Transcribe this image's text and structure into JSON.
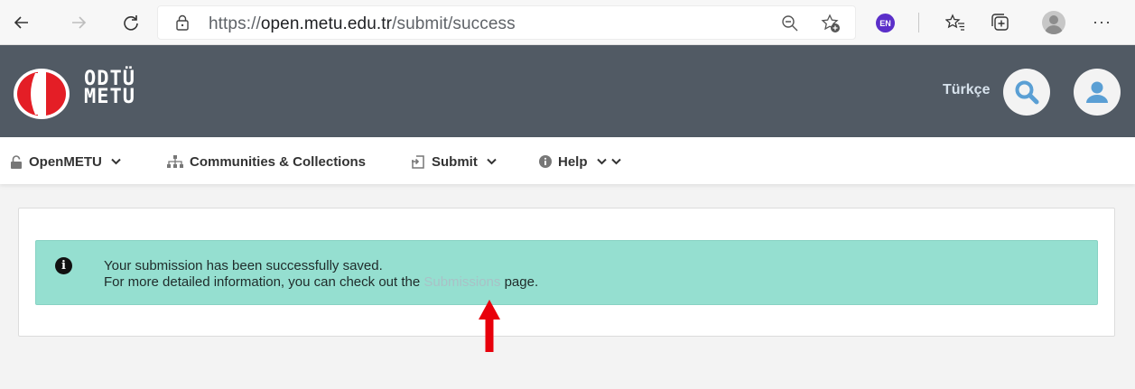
{
  "browser": {
    "url_prefix": "https://",
    "url_domain": "open.metu.edu.tr",
    "url_path": "/submit/success",
    "extension_badge": "EN",
    "more_label": "···"
  },
  "header": {
    "logo_line1": "ODTÜ",
    "logo_line2": "METU",
    "language_label": "Türkçe",
    "logo_red": "#e41e26"
  },
  "menu": {
    "items": [
      {
        "label": "OpenMETU",
        "icon": "lock-open-icon"
      },
      {
        "label": "Communities & Collections",
        "icon": "sitemap-icon"
      },
      {
        "label": "Submit",
        "icon": "submit-icon"
      },
      {
        "label": "Help",
        "icon": "info-circle-icon"
      }
    ]
  },
  "alert": {
    "line1": "Your submission has been successfully saved.",
    "line2_before": "For more detailed information, you can check out the",
    "link_label": "Submissions",
    "line2_after": "page.",
    "bg_color": "#95dfd0"
  },
  "annotation": {
    "arrow_color": "#e8000b"
  }
}
